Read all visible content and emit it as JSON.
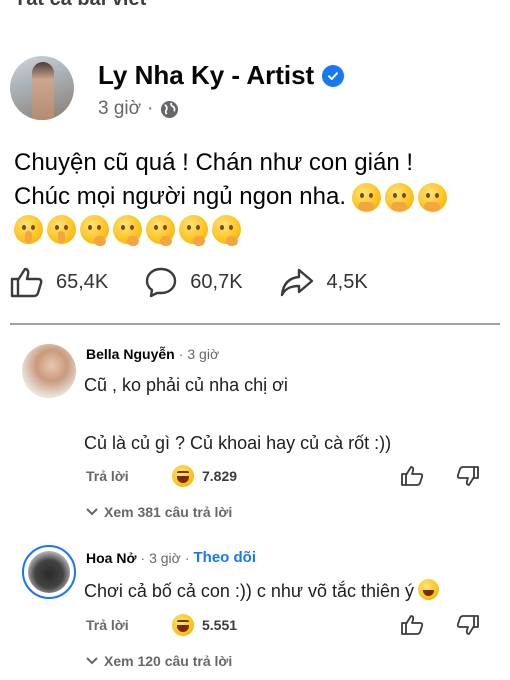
{
  "page_header": {
    "cut_text": "Tất cả bài viết"
  },
  "post": {
    "author": "Ly Nha Ky - Artist",
    "time": "3 giờ",
    "separator": "·",
    "text_line1": "Chuyện cũ quá ! Chán như con gián !",
    "text_line2": "Chúc mọi người ngủ ngon nha.",
    "emojis_line2": [
      "hand-over-mouth",
      "hand-over-mouth",
      "hand-over-mouth"
    ],
    "emojis_line3": [
      "shushing-face",
      "shushing-face",
      "thinking-face",
      "thinking-face",
      "thinking-face",
      "thinking-face",
      "thinking-face"
    ],
    "likes": "65,4K",
    "comments": "60,7K",
    "shares": "4,5K"
  },
  "comments": [
    {
      "author": "Bella Nguyễn",
      "time": "3 giờ",
      "line1": "Cũ , ko phải củ nha chị ơi",
      "line2": "Củ là củ gì ? Củ khoai hay củ cà rốt :))",
      "reply_label": "Trả lời",
      "reaction_count": "7.829",
      "view_replies": "Xem 381 câu trả lời"
    },
    {
      "author": "Hoa Nở",
      "time": "3 giờ",
      "follow_label": "Theo dõi",
      "line1": "Chơi cả bố cả con :)) c như võ tắc thiên ý",
      "reply_label": "Trả lời",
      "reaction_count": "5.551",
      "view_replies": "Xem 120 câu trả lời"
    }
  ],
  "colors": {
    "accent": "#1877f2",
    "secondary_text": "#65676b",
    "divider": "#9ea1a5"
  }
}
